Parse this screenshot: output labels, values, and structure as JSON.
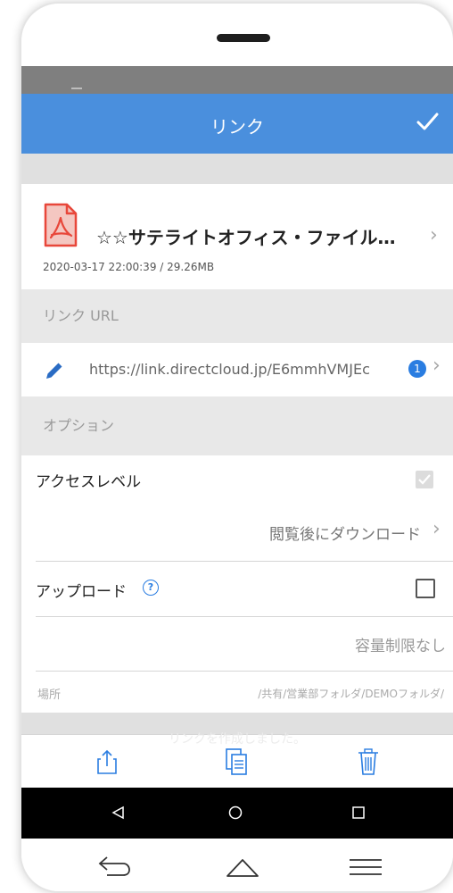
{
  "appbar": {
    "title": "リンク",
    "check_icon": "check-icon"
  },
  "file": {
    "name": "☆☆サテライトオフィス・ファイル…",
    "meta": "2020-03-17 22:00:39  /  29.26MB",
    "icon": "pdf-file-icon",
    "icon_color": "#e8473a"
  },
  "link_url": {
    "header": "リンク URL",
    "url": "https://link.directcloud.jp/E6mmhVMJEc",
    "badge": "1",
    "edit_icon": "pencil-icon"
  },
  "options": {
    "header": "オプション",
    "access_level_label": "アクセスレベル",
    "access_level_checked": true,
    "access_level_value": "閲覧後にダウンロード",
    "upload_label": "アップロード",
    "upload_checked": false,
    "upload_value": "容量制限なし",
    "location_label": "場所",
    "location_value": "/共有/営業部フォルダ/DEMOフォルダ/"
  },
  "toast": "リンクを作成しました。",
  "toolbar": {
    "share_icon": "share-icon",
    "copy_icon": "copy-icon",
    "delete_icon": "trash-icon"
  },
  "android_nav": {
    "back": "back-triangle-icon",
    "home": "home-circle-icon",
    "recent": "recent-square-icon"
  },
  "hardware_nav": {
    "back": "back-arrow-icon",
    "home": "home-outline-icon",
    "menu": "menu-lines-icon"
  },
  "colors": {
    "accent": "#4a8fdd",
    "badge": "#2a7de1",
    "pdf_red": "#e8473a"
  }
}
